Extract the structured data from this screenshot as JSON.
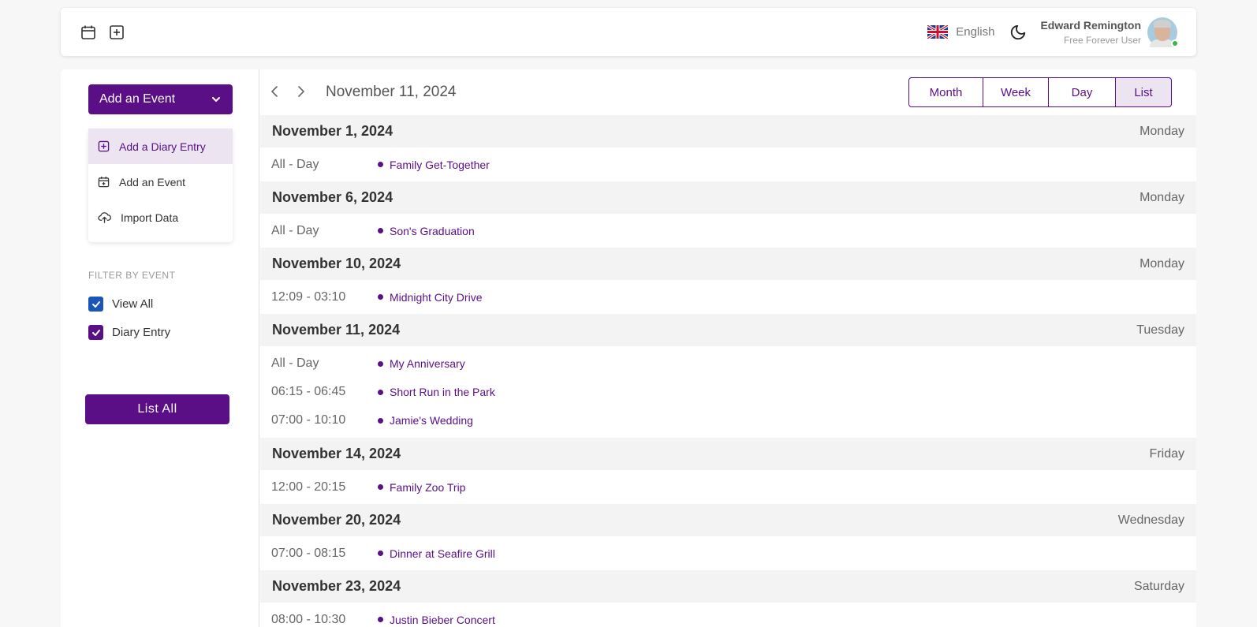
{
  "header": {
    "language": "English",
    "user_name": "Edward Remington",
    "user_role": "Free Forever User"
  },
  "sidebar": {
    "add_event_label": "Add an Event",
    "dropdown": [
      {
        "label": "Add a Diary Entry",
        "icon": "plus-square-icon"
      },
      {
        "label": "Add an Event",
        "icon": "calendar-plus-icon"
      },
      {
        "label": "Import Data",
        "icon": "cloud-upload-icon"
      }
    ],
    "filter_title": "FILTER BY EVENT",
    "filters": [
      {
        "label": "View All",
        "checked": true,
        "color": "#1a56b8"
      },
      {
        "label": "Diary Entry",
        "checked": true,
        "color": "#5a0f86"
      }
    ],
    "list_all_label": "List All"
  },
  "toolbar": {
    "current_date": "November 11, 2024",
    "views": [
      "Month",
      "Week",
      "Day",
      "List"
    ],
    "active_view": "List"
  },
  "colors": {
    "accent": "#5a0f86",
    "accent_light": "#ece4f1",
    "online": "#3bb54a"
  },
  "days": [
    {
      "date": "November 1, 2024",
      "weekday": "Monday",
      "events": [
        {
          "time": "All - Day",
          "title": "Family Get-Together"
        }
      ]
    },
    {
      "date": "November 6, 2024",
      "weekday": "Monday",
      "events": [
        {
          "time": "All - Day",
          "title": "Son's Graduation"
        }
      ]
    },
    {
      "date": "November 10, 2024",
      "weekday": "Monday",
      "events": [
        {
          "time": "12:09 - 03:10",
          "title": "Midnight City Drive"
        }
      ]
    },
    {
      "date": "November 11, 2024",
      "weekday": "Tuesday",
      "events": [
        {
          "time": "All - Day",
          "title": "My Anniversary"
        },
        {
          "time": "06:15 - 06:45",
          "title": "Short Run in the Park"
        },
        {
          "time": "07:00 - 10:10",
          "title": "Jamie's Wedding"
        }
      ]
    },
    {
      "date": "November 14, 2024",
      "weekday": "Friday",
      "events": [
        {
          "time": "12:00 - 20:15",
          "title": "Family Zoo Trip"
        }
      ]
    },
    {
      "date": "November 20, 2024",
      "weekday": "Wednesday",
      "events": [
        {
          "time": "07:00 - 08:15",
          "title": "Dinner at Seafire Grill"
        }
      ]
    },
    {
      "date": "November 23, 2024",
      "weekday": "Saturday",
      "events": [
        {
          "time": "08:00 - 10:30",
          "title": "Justin Bieber Concert"
        }
      ]
    }
  ]
}
